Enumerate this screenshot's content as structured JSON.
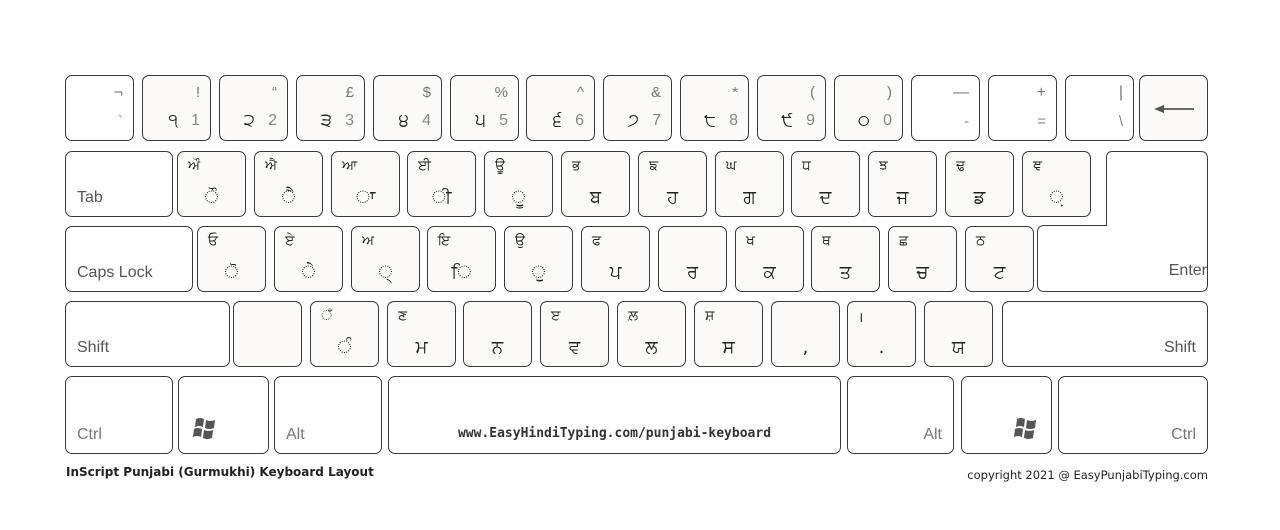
{
  "title": "InScript Punjabi (Gurmukhi) Keyboard Layout",
  "copyright": "copyright 2021 @ EasyPunjabiTyping.com",
  "spacebar_text": "www.EasyHindiTyping.com/punjabi-keyboard",
  "row1": [
    {
      "shift": "¬",
      "base": "`",
      "pa": ""
    },
    {
      "shift": "!",
      "base": "1",
      "pa": "੧"
    },
    {
      "shift": "“",
      "base": "2",
      "pa": "੨"
    },
    {
      "shift": "£",
      "base": "3",
      "pa": "੩"
    },
    {
      "shift": "$",
      "base": "4",
      "pa": "੪"
    },
    {
      "shift": "%",
      "base": "5",
      "pa": "੫"
    },
    {
      "shift": "^",
      "base": "6",
      "pa": "੬"
    },
    {
      "shift": "&",
      "base": "7",
      "pa": "੭"
    },
    {
      "shift": "*",
      "base": "8",
      "pa": "੮"
    },
    {
      "shift": "(",
      "base": "9",
      "pa": "੯"
    },
    {
      "shift": ")",
      "base": "0",
      "pa": "੦"
    },
    {
      "shift": "—",
      "base": "-",
      "pa": ""
    },
    {
      "shift": "+",
      "base": "=",
      "pa": ""
    },
    {
      "shift": "|",
      "base": "\\",
      "pa": ""
    }
  ],
  "row2": [
    {
      "top": "ਔ",
      "main": "ੌ"
    },
    {
      "top": "ਐ",
      "main": "ੈ"
    },
    {
      "top": "ਆ",
      "main": "ਾ"
    },
    {
      "top": "ਈ",
      "main": "ੀ"
    },
    {
      "top": "ਊ",
      "main": "ੂ"
    },
    {
      "top": "ਭ",
      "main": "ਬ"
    },
    {
      "top": "ਙ",
      "main": "ਹ"
    },
    {
      "top": "ਘ",
      "main": "ਗ"
    },
    {
      "top": "ਧ",
      "main": "ਦ"
    },
    {
      "top": "ਝ",
      "main": "ਜ"
    },
    {
      "top": "ਢ",
      "main": "ਡ"
    },
    {
      "top": "ਞ",
      "main": "਼"
    }
  ],
  "row3": [
    {
      "top": "ਓ",
      "main": "ੋ"
    },
    {
      "top": "ਏ",
      "main": "ੇ"
    },
    {
      "top": "ਅ",
      "main": "੍"
    },
    {
      "top": "ਇ",
      "main": "ਿ"
    },
    {
      "top": "ਉ",
      "main": "ੁ"
    },
    {
      "top": "ਫ",
      "main": "ਪ"
    },
    {
      "top": "",
      "main": "ਰ"
    },
    {
      "top": "ਖ",
      "main": "ਕ"
    },
    {
      "top": "ਥ",
      "main": "ਤ"
    },
    {
      "top": "ਛ",
      "main": "ਚ"
    },
    {
      "top": "ਠ",
      "main": "ਟ"
    }
  ],
  "row4": [
    {
      "top": "",
      "main": ""
    },
    {
      "top": "ਁ",
      "main": "ੰ"
    },
    {
      "top": "ਣ",
      "main": "ਮ"
    },
    {
      "top": "",
      "main": "ਨ"
    },
    {
      "top": "ੲ",
      "main": "ਵ"
    },
    {
      "top": "ਲ਼",
      "main": "ਲ"
    },
    {
      "top": "ਸ਼",
      "main": "ਸ"
    },
    {
      "top": "",
      "main": ","
    },
    {
      "top": "।",
      "main": "."
    },
    {
      "top": "",
      "main": "ਯ"
    }
  ],
  "labels": {
    "tab": "Tab",
    "caps": "Caps Lock",
    "enter": "Enter",
    "shift_left": "Shift",
    "shift_right": "Shift",
    "ctrl_left": "Ctrl",
    "alt_left": "Alt",
    "alt_right": "Alt",
    "ctrl_right": "Ctrl"
  },
  "icons": {
    "backspace": "left-arrow",
    "windows": "windows-logo"
  }
}
